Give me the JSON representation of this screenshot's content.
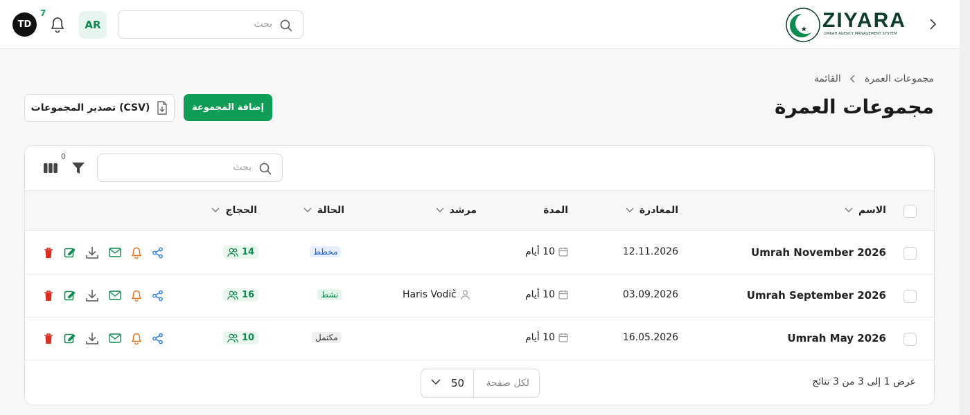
{
  "header": {
    "user_initials": "TD",
    "notification_count": "7",
    "language": "AR",
    "search_placeholder": "بحث",
    "logo_name": "ZIYARA",
    "logo_tagline": "UMRAH AGENCY MANAGEMENT SYSTEM"
  },
  "breadcrumb": {
    "parent": "مجموعات العمرة",
    "current": "القائمة"
  },
  "page_title": "مجموعات العمرة",
  "actions": {
    "add_label": "إضافة المجموعة",
    "export_label": "تصدير المجموعات (CSV)"
  },
  "table": {
    "search_placeholder": "بحث",
    "filter_count": "0",
    "columns": {
      "name": "الاسم",
      "departure": "المغادرة",
      "duration": "المدة",
      "guide": "مرشد",
      "status": "الحالة",
      "pilgrims": "الحجاج"
    },
    "rows": [
      {
        "name": "Umrah November 2026",
        "departure": "12.11.2026",
        "duration": "10 أيام",
        "guide": "",
        "status": "مخطط",
        "status_color": "#1a5fd0",
        "status_bg": "#e7effc",
        "pilgrims": "14"
      },
      {
        "name": "Umrah September 2026",
        "departure": "03.09.2026",
        "duration": "10 أيام",
        "guide": "Haris Vodič",
        "status": "نشط",
        "status_color": "#0f8a4f",
        "status_bg": "#e3f5eb",
        "pilgrims": "16"
      },
      {
        "name": "Umrah May 2026",
        "departure": "16.05.2026",
        "duration": "10 أيام",
        "guide": "",
        "status": "مكتمل",
        "status_color": "#333333",
        "status_bg": "#efefef",
        "pilgrims": "10"
      }
    ]
  },
  "footer": {
    "results_text": "عرض 1 إلى 3 من 3 نتائج",
    "per_page_label": "لكل صفحة",
    "per_page_value": "50"
  },
  "colors": {
    "primary": "#0f9d58",
    "delete": "#d92d20",
    "notify": "#e8711a",
    "share": "#2a7be4"
  },
  "icons": [
    "search-icon",
    "bell-icon",
    "chevron-right-icon",
    "file-download-icon",
    "columns-icon",
    "filter-icon",
    "calendar-icon",
    "user-icon",
    "users-icon",
    "share-icon",
    "bell-outline-icon",
    "mail-icon",
    "download-icon",
    "edit-icon",
    "trash-icon",
    "chevron-down-icon"
  ]
}
